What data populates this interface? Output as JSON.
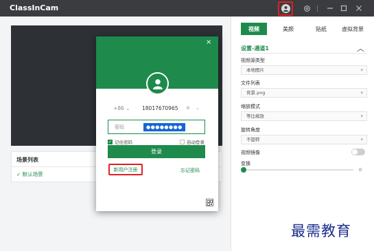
{
  "app": {
    "title": "ClassInCam",
    "colors": {
      "accent": "#1e8a4c",
      "titlebar": "#3b3c3f",
      "highlight": "#e01f26"
    }
  },
  "titlebar": {
    "icons": [
      "user-avatar-icon",
      "gear-icon",
      "minimize-icon",
      "maximize-icon",
      "close-icon"
    ]
  },
  "scenes": {
    "title": "场景列表",
    "items": [
      {
        "label": "✓ 默认场景"
      }
    ]
  },
  "right_panel": {
    "tabs": [
      {
        "label": "视频"
      },
      {
        "label": "美颜"
      },
      {
        "label": "贴纸"
      },
      {
        "label": "虚拟背景"
      }
    ],
    "section_title": "设置-通道1",
    "fields": [
      {
        "label": "视频源类型",
        "value": "本地图片"
      },
      {
        "label": "文件列表",
        "value": "背景.png"
      },
      {
        "label": "缩放模式",
        "value": "等比缩放"
      },
      {
        "label": "旋转角度",
        "value": "不旋转"
      }
    ],
    "mirror_label": "视频镜像",
    "mirror_on": false,
    "transform_label": "变换",
    "transform_value": "0"
  },
  "login": {
    "country_code": "+86",
    "phone": "18017670965",
    "password_placeholder": "密码",
    "password_value": "●●●●●●●●",
    "remember_label": "记住密码",
    "remember_checked": true,
    "auto_login_label": "自动登录",
    "auto_login_checked": false,
    "login_button": "登录",
    "register_link": "新用户注册",
    "forgot_link": "忘记密码"
  },
  "watermark": "最需教育"
}
